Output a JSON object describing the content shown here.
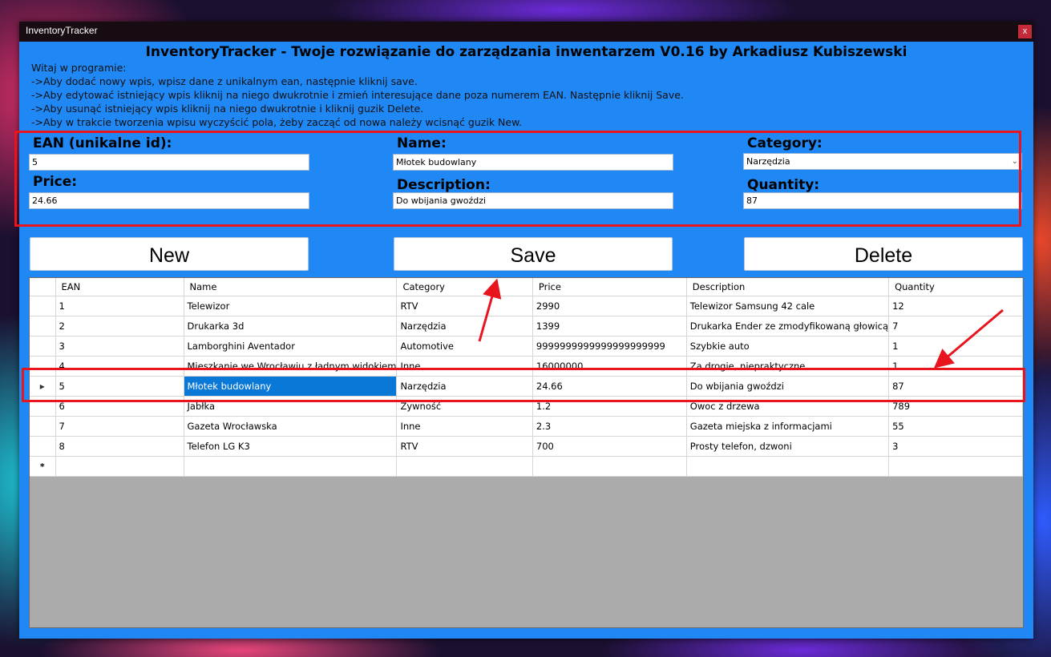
{
  "window": {
    "title": "InventoryTracker",
    "close_label": "x"
  },
  "header": {
    "title": "InventoryTracker - Twoje rozwiązanie do zarządzania inwentarzem V0.16 by Arkadiusz Kubiszewski"
  },
  "instructions": [
    "Witaj w programie:",
    "->Aby dodać nowy wpis, wpisz dane z unikalnym ean, następnie kliknij save.",
    "->Aby edytować istniejący wpis kliknij na niego dwukrotnie i zmień interesujące dane poza numerem EAN. Następnie kliknij Save.",
    "->Aby usunąć istniejący wpis kliknij na niego dwukrotnie i kliknij guzik Delete.",
    "->Aby w trakcie tworzenia wpisu wyczyścić pola, żeby zacząć od nowa należy wcisnąć guzik New."
  ],
  "form": {
    "ean_label": "EAN (unikalne id):",
    "ean_value": "5",
    "name_label": "Name:",
    "name_value": "Młotek budowlany",
    "category_label": "Category:",
    "category_value": "Narzędzia",
    "price_label": "Price:",
    "price_value": "24.66",
    "description_label": "Description:",
    "description_value": "Do wbijania gwoździ",
    "quantity_label": "Quantity:",
    "quantity_value": "87"
  },
  "buttons": {
    "new_label": "New",
    "save_label": "Save",
    "delete_label": "Delete"
  },
  "table": {
    "columns": [
      "EAN",
      "Name",
      "Category",
      "Price",
      "Description",
      "Quantity"
    ],
    "rows": [
      [
        "1",
        "Telewizor",
        "RTV",
        "2990",
        "Telewizor Samsung 42 cale",
        "12"
      ],
      [
        "2",
        "Drukarka 3d",
        "Narzędzia",
        "1399",
        "Drukarka Ender ze zmodyfikowaną głowicą",
        "7"
      ],
      [
        "3",
        "Lamborghini Aventador",
        "Automotive",
        "9999999999999999999999",
        "Szybkie auto",
        "1"
      ],
      [
        "4",
        "Mieszkanie we Wrocławiu z ładnym widokiem",
        "Inne",
        "16000000",
        "Za drogie, niepraktyczne",
        "1"
      ],
      [
        "5",
        "Młotek budowlany",
        "Narzędzia",
        "24.66",
        "Do wbijania gwoździ",
        "87"
      ],
      [
        "6",
        "Jabłka",
        "Żywność",
        "1.2",
        "Owoc z drzewa",
        "789"
      ],
      [
        "7",
        "Gazeta Wrocławska",
        "Inne",
        "2.3",
        "Gazeta miejska z informacjami",
        "55"
      ],
      [
        "8",
        "Telefon LG K3",
        "RTV",
        "700",
        "Prosty telefon, dzwoni",
        "3"
      ]
    ],
    "current_row_marker": "▸",
    "new_row_marker": "*"
  },
  "colors": {
    "window_bg": "#2088f5",
    "annotation_red": "#e8141e",
    "selection_blue": "#0a78d7"
  }
}
